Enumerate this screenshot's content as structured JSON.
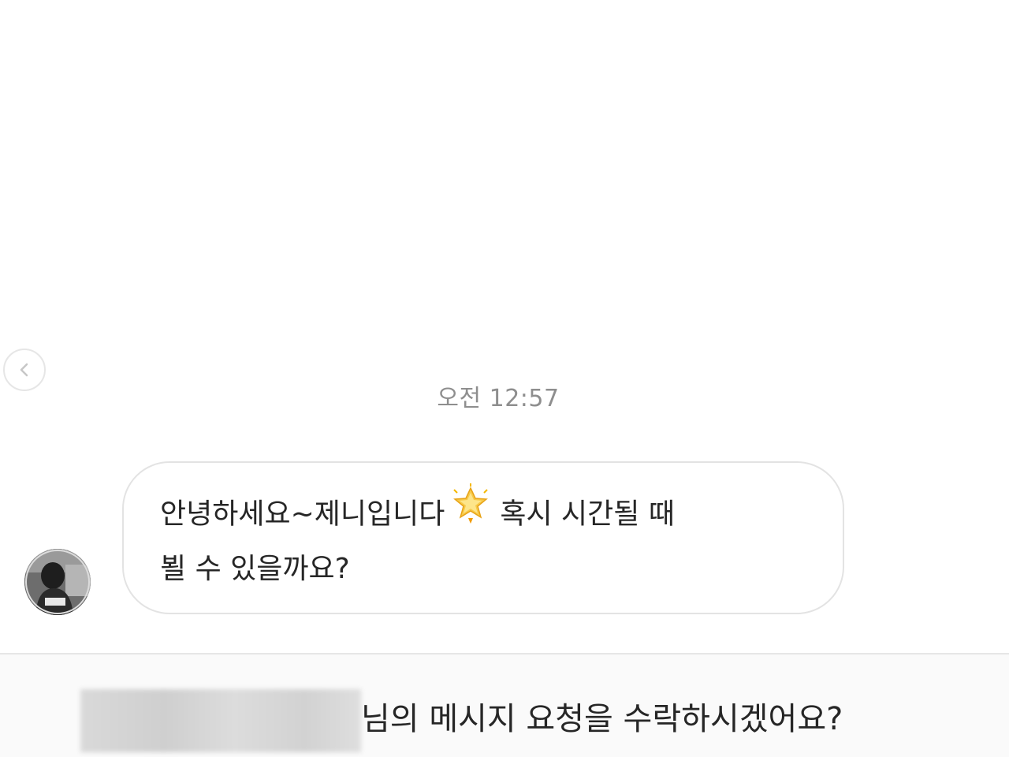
{
  "thread": {
    "timestamp": "오전 12:57"
  },
  "message": {
    "line1_before_emoji": "안녕하세요~제니입니다",
    "emoji_icon": "glowing-star-icon",
    "line1_after_emoji": "혹시 시간될 때",
    "line2": "뵐 수 있을까요?"
  },
  "request_bar": {
    "prompt_text": "님의 메시지 요청을 수락하시겠어요?"
  },
  "icons": {
    "back": "chevron-left-icon",
    "sender_avatar": "avatar"
  },
  "colors": {
    "background": "#ffffff",
    "timestamp": "#8e8e8e",
    "bubble_border": "#e3e3e3",
    "text": "#262626",
    "request_bar_bg": "#fafafa"
  }
}
